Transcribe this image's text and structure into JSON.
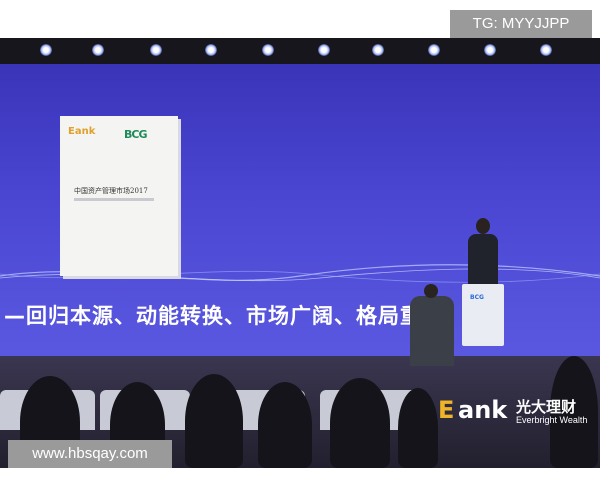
{
  "watermark_top": "TG: MYYJJPP",
  "watermark_bottom": "www.hbsqay.com",
  "screen": {
    "slogan": "—回归本源、动能转换、市场广阔、格局重",
    "report_logo_left": "Eank",
    "report_logo_right": "BCG",
    "report_title": "中国资产管理市场2017",
    "podium_logo": "BCG"
  },
  "brand": {
    "logo_e": "E",
    "logo_ank": "ank",
    "name_cn": "光大理财",
    "name_en": "Everbright Wealth"
  },
  "colors": {
    "screen": "#4a46d2",
    "brand_accent": "#f0b428",
    "badge": "#9a9a9a"
  }
}
